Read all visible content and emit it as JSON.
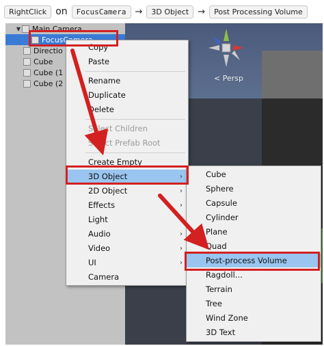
{
  "instruction": {
    "step1": "RightClick",
    "word_on": "on",
    "target": "FocusCamera",
    "arrow": "→",
    "step2": "3D Object",
    "step3": "Post Processing Volume"
  },
  "hierarchy": {
    "items": [
      {
        "label": "Main Camera"
      },
      {
        "label": "FocusCamera"
      },
      {
        "label": "Directio"
      },
      {
        "label": "Cube"
      },
      {
        "label": "Cube (1"
      },
      {
        "label": "Cube (2"
      }
    ]
  },
  "scene": {
    "persp_label": "Persp"
  },
  "context_menu": {
    "items": [
      {
        "label": "Copy"
      },
      {
        "label": "Paste"
      },
      {
        "label": "Rename"
      },
      {
        "label": "Duplicate"
      },
      {
        "label": "Delete"
      },
      {
        "label": "Select Children"
      },
      {
        "label": "Select Prefab Root"
      },
      {
        "label": "Create Empty"
      },
      {
        "label": "3D Object"
      },
      {
        "label": "2D Object"
      },
      {
        "label": "Effects"
      },
      {
        "label": "Light"
      },
      {
        "label": "Audio"
      },
      {
        "label": "Video"
      },
      {
        "label": "UI"
      },
      {
        "label": "Camera"
      }
    ],
    "submenu_arrow": "›"
  },
  "submenu_3d": {
    "items": [
      {
        "label": "Cube"
      },
      {
        "label": "Sphere"
      },
      {
        "label": "Capsule"
      },
      {
        "label": "Cylinder"
      },
      {
        "label": "Plane"
      },
      {
        "label": "Quad"
      },
      {
        "label": "Post-process Volume"
      },
      {
        "label": "Ragdoll..."
      },
      {
        "label": "Terrain"
      },
      {
        "label": "Tree"
      },
      {
        "label": "Wind Zone"
      },
      {
        "label": "3D Text"
      }
    ]
  },
  "colors": {
    "highlight": "#99c5f0",
    "annotation_red": "#d32020",
    "selection_blue": "#3a7bd5"
  }
}
